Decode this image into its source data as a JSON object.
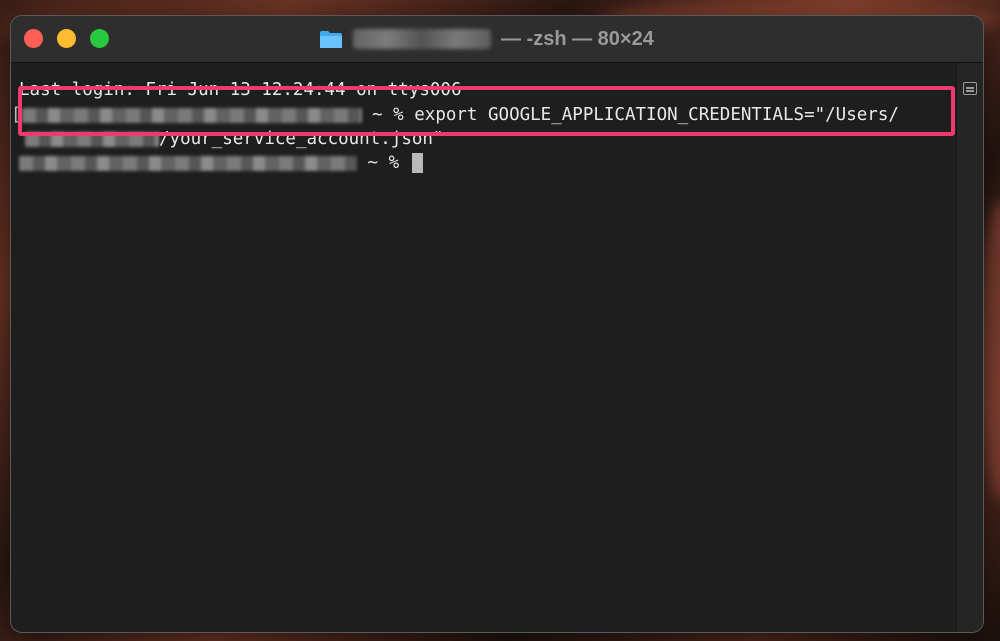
{
  "window": {
    "title_suffix": "— -zsh — 80×24",
    "controls": {
      "close_color": "#ff5f57",
      "minimize_color": "#febc2e",
      "zoom_color": "#28c840"
    }
  },
  "terminal": {
    "last_login": "Last login: Fri Jun 13 12:24:44 on ttys006",
    "prompt": "~ %",
    "command_part1": "export GOOGLE_APPLICATION_CREDENTIALS=\"/Users/",
    "command_part2": "/your_service_account.json\"",
    "prompt2": "~ %"
  },
  "highlight_color": "#ef3a6e",
  "icons": [
    "folder-icon",
    "scroll-split-icon"
  ]
}
